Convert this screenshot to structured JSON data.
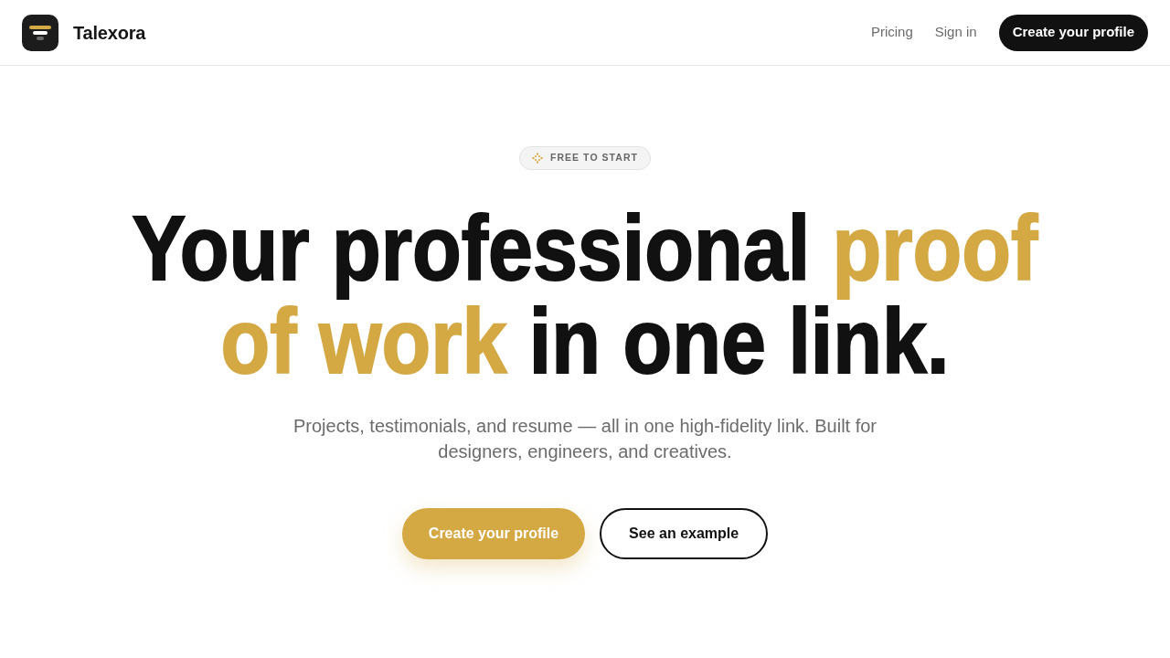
{
  "navbar": {
    "brand": "Talexora",
    "links": [
      {
        "label": "Pricing"
      },
      {
        "label": "Sign in"
      }
    ],
    "cta": "Create your profile"
  },
  "hero": {
    "badge": "FREE TO START",
    "headline": [
      [
        {
          "text": "Your professional ",
          "accent": false
        },
        {
          "text": "proof",
          "accent": true
        }
      ],
      [
        {
          "text": "of work",
          "accent": true
        },
        {
          "text": " in one link.",
          "accent": false
        }
      ]
    ],
    "subtitle": "Projects, testimonials, and resume — all in one high-fidelity link. Built for designers, engineers, and creatives.",
    "buttons": [
      {
        "label": "Create your profile",
        "kind": "primary"
      },
      {
        "label": "See an example",
        "kind": "outline"
      }
    ]
  }
}
